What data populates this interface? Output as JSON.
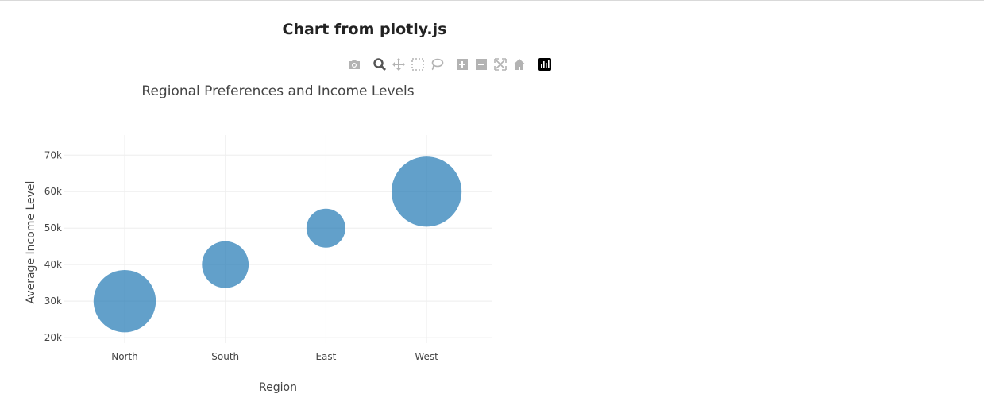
{
  "page": {
    "title": "Chart from plotly.js"
  },
  "modebar": {
    "buttons": [
      {
        "name": "camera-icon",
        "color": "#b3b3b3"
      },
      {
        "name": "zoom-icon",
        "color": "#555555"
      },
      {
        "name": "pan-icon",
        "color": "#b3b3b3"
      },
      {
        "name": "box-select-icon",
        "color": "#b3b3b3"
      },
      {
        "name": "lasso-icon",
        "color": "#b3b3b3"
      },
      {
        "name": "zoom-in-icon",
        "color": "#b3b3b3"
      },
      {
        "name": "zoom-out-icon",
        "color": "#b3b3b3"
      },
      {
        "name": "autoscale-icon",
        "color": "#b3b3b3"
      },
      {
        "name": "reset-axes-icon",
        "color": "#b3b3b3"
      },
      {
        "name": "plotly-logo-icon",
        "color": "#000000"
      }
    ]
  },
  "chart_data": {
    "type": "scatter",
    "mode": "markers",
    "title": "Regional Preferences and Income Levels",
    "xlabel": "Region",
    "ylabel": "Average Income Level",
    "categories": [
      "North",
      "South",
      "East",
      "West"
    ],
    "series": [
      {
        "x": [
          "North",
          "South",
          "East",
          "West"
        ],
        "y": [
          30000,
          40000,
          50000,
          60000
        ],
        "marker_size": [
          40,
          30,
          25,
          45
        ],
        "color": "#1f77b4",
        "opacity": 0.7
      }
    ],
    "yticks": [
      20000,
      30000,
      40000,
      50000,
      60000,
      70000
    ],
    "ytick_labels": [
      "20k",
      "30k",
      "40k",
      "50k",
      "60k",
      "70k"
    ],
    "ylim": [
      18500,
      75500
    ],
    "grid": true,
    "legend": false
  }
}
